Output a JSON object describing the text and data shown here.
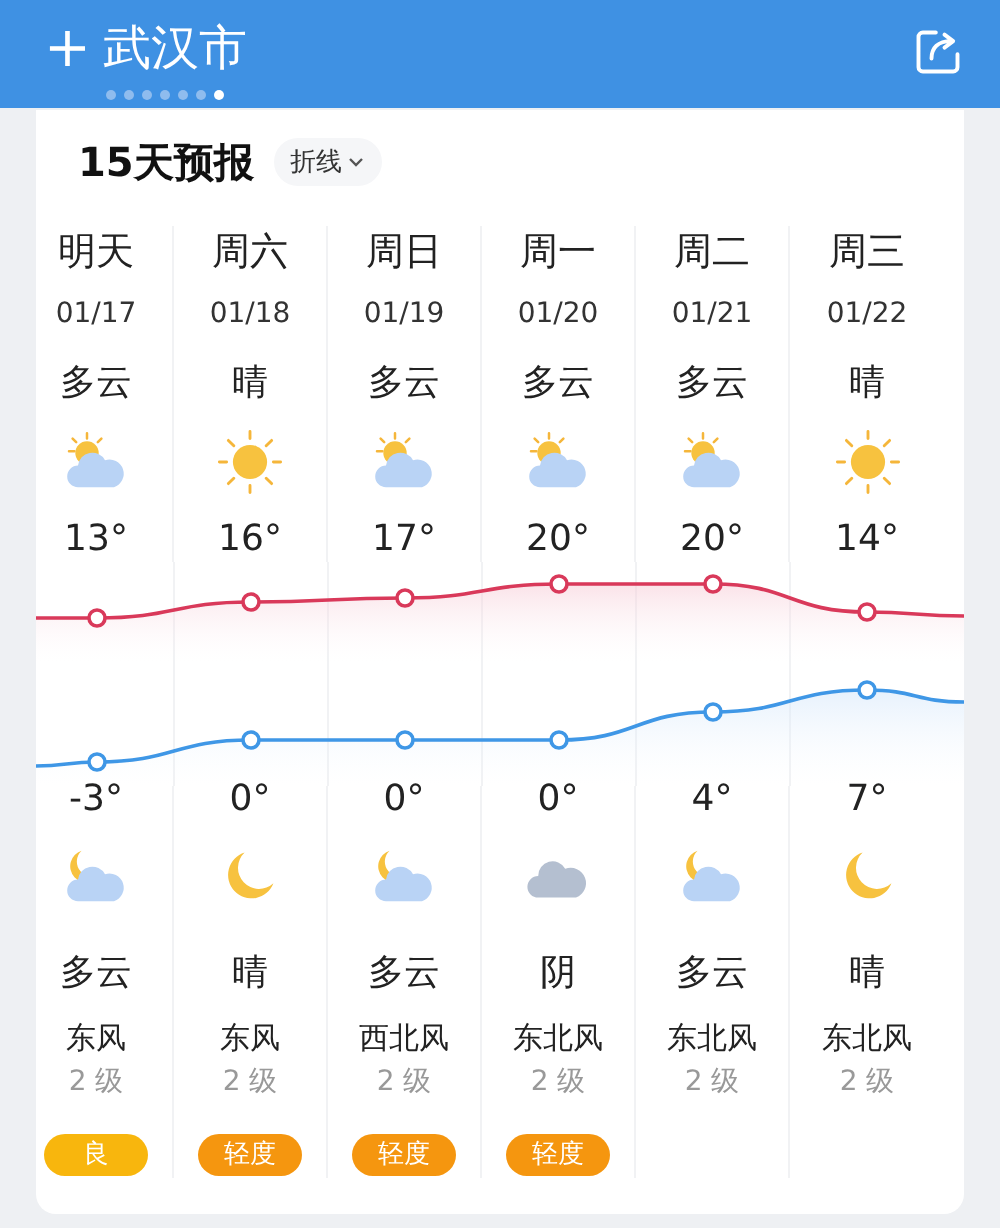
{
  "header": {
    "add": "+",
    "city": "武汉市",
    "pages": [
      {
        "selected": false
      },
      {
        "selected": false
      },
      {
        "selected": false
      },
      {
        "selected": false
      },
      {
        "selected": false
      },
      {
        "selected": false
      },
      {
        "selected": true
      }
    ]
  },
  "forecast": {
    "title": "15天预报",
    "mode": "折线",
    "days": [
      {
        "name": "明天",
        "date": "01/17",
        "day": {
          "condition": "多云",
          "kind": "partly-cloudy"
        },
        "high": "13°",
        "low": "-3°",
        "night": {
          "kind": "moon-cloud",
          "condition": "多云"
        },
        "wind": "东风",
        "wind_level": "2 级",
        "aqi": {
          "text": "良",
          "color": "#f8b60d"
        }
      },
      {
        "name": "周六",
        "date": "01/18",
        "day": {
          "condition": "晴",
          "kind": "sunny"
        },
        "high": "16°",
        "low": "0°",
        "night": {
          "kind": "moon",
          "condition": "晴"
        },
        "wind": "东风",
        "wind_level": "2 级",
        "aqi": {
          "text": "轻度",
          "color": "#f5960f"
        }
      },
      {
        "name": "周日",
        "date": "01/19",
        "day": {
          "condition": "多云",
          "kind": "partly-cloudy"
        },
        "high": "17°",
        "low": "0°",
        "night": {
          "kind": "moon-cloud",
          "condition": "多云"
        },
        "wind": "西北风",
        "wind_level": "2 级",
        "aqi": {
          "text": "轻度",
          "color": "#f5960f"
        }
      },
      {
        "name": "周一",
        "date": "01/20",
        "day": {
          "condition": "多云",
          "kind": "partly-cloudy"
        },
        "high": "20°",
        "low": "0°",
        "night": {
          "kind": "overcast",
          "condition": "阴"
        },
        "wind": "东北风",
        "wind_level": "2 级",
        "aqi": {
          "text": "轻度",
          "color": "#f5960f"
        }
      },
      {
        "name": "周二",
        "date": "01/21",
        "day": {
          "condition": "多云",
          "kind": "partly-cloudy"
        },
        "high": "20°",
        "low": "4°",
        "night": {
          "kind": "moon-cloud",
          "condition": "多云"
        },
        "wind": "东北风",
        "wind_level": "2 级"
      },
      {
        "name": "周三",
        "date": "01/22",
        "day": {
          "condition": "晴",
          "kind": "sunny"
        },
        "high": "14°",
        "low": "7°",
        "night": {
          "kind": "moon",
          "condition": "晴"
        },
        "wind": "东北风",
        "wind_level": "2 级"
      }
    ]
  }
}
